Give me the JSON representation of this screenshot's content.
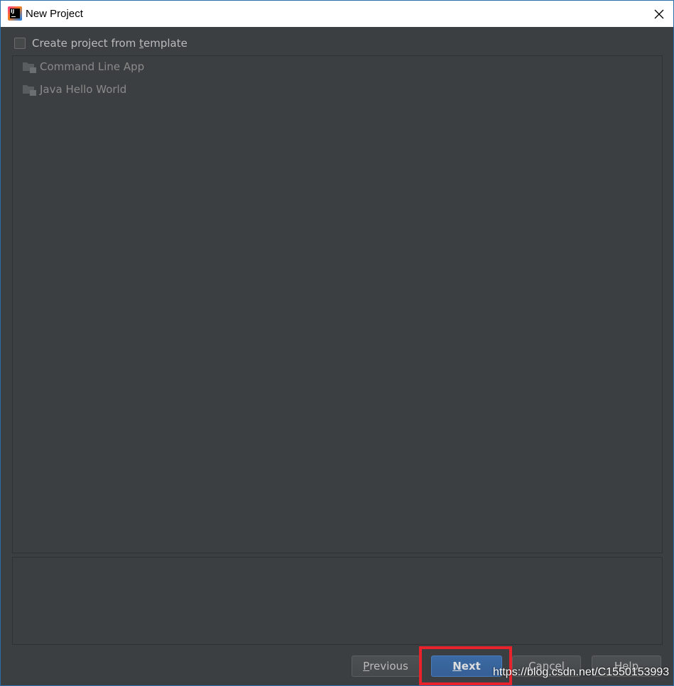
{
  "window": {
    "title": "New Project",
    "icon": "intellij-idea-icon",
    "close_icon": "close-icon"
  },
  "template_option": {
    "label_before": "Create project from ",
    "label_mnemonic": "t",
    "label_after": "emplate",
    "checked": false
  },
  "templates": {
    "items": [
      {
        "label": "Command Line App",
        "icon": "folder-icon"
      },
      {
        "label": "Java Hello World",
        "icon": "folder-icon"
      }
    ]
  },
  "buttons": {
    "previous": {
      "mnemonic": "P",
      "rest": "revious"
    },
    "next": {
      "mnemonic": "N",
      "rest": "ext"
    },
    "cancel": {
      "label": "Cancel"
    },
    "help": {
      "label": "Help"
    }
  },
  "watermark": "https://blog.csdn.net/C1550153993",
  "colors": {
    "dialog_background": "#3c3f41",
    "default_button": "#365880",
    "highlight": "#e8232b"
  }
}
